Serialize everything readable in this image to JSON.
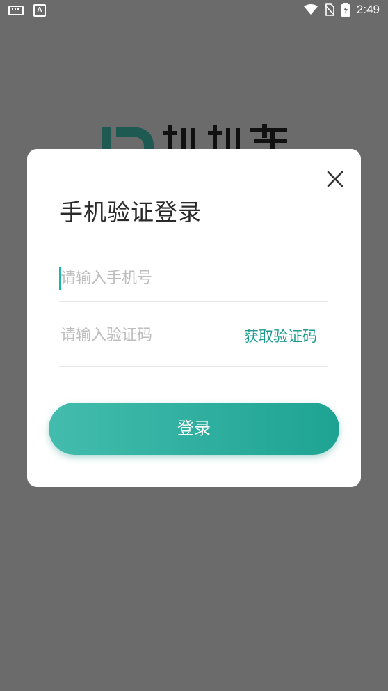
{
  "status_bar": {
    "time": "2:49",
    "left_icons": [
      "keyboard-icon",
      "text-a-icon"
    ],
    "right_icons": [
      "wifi-icon",
      "no-sim-icon",
      "battery-charging-icon"
    ]
  },
  "background": {
    "logo_text": "批批车"
  },
  "dialog": {
    "title": "手机验证登录",
    "phone_placeholder": "请输入手机号",
    "phone_value": "",
    "code_placeholder": "请输入验证码",
    "code_value": "",
    "get_code_label": "获取验证码",
    "login_label": "登录"
  },
  "colors": {
    "overlay": "#6b6b6b",
    "accent": "#1d9a8f",
    "button_gradient_start": "#43bcad",
    "button_gradient_end": "#1ea393"
  }
}
